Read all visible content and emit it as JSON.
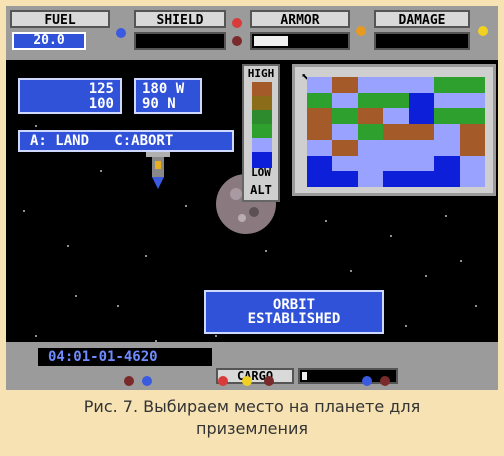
{
  "gauges": {
    "fuel_label": "FUEL",
    "fuel_value": "20.0",
    "shield_label": "SHIELD",
    "armor_label": "ARMOR",
    "damage_label": "DAMAGE",
    "shield_level": 0.0,
    "armor_level": 0.35,
    "damage_level": 0.0
  },
  "navigation": {
    "coord_1": "125",
    "coord_2": "100",
    "lat": "180 W",
    "lon": "90 N",
    "commands": "A: LAND   C:ABORT"
  },
  "altitude_legend": {
    "high": "HIGH",
    "low": "LOW",
    "alt": "ALT",
    "colors": [
      "#a55a2a",
      "#8b6c19",
      "#2d8b2d",
      "#2ea02e",
      "#9aa2ff",
      "#0d1fd8"
    ]
  },
  "map": {
    "cells": [
      [
        "#9aa2ff",
        "#a55a2a",
        "#9aa2ff",
        "#9aa2ff",
        "#9aa2ff",
        "#2ea02e",
        "#2ea02e"
      ],
      [
        "#2ea02e",
        "#9aa2ff",
        "#2ea02e",
        "#2ea02e",
        "#0d1fd8",
        "#9aa2ff",
        "#9aa2ff"
      ],
      [
        "#a55a2a",
        "#2ea02e",
        "#a55a2a",
        "#9aa2ff",
        "#0d1fd8",
        "#2ea02e",
        "#2ea02e"
      ],
      [
        "#a55a2a",
        "#9aa2ff",
        "#2ea02e",
        "#a55a2a",
        "#a55a2a",
        "#9aa2ff",
        "#a55a2a"
      ],
      [
        "#9aa2ff",
        "#a55a2a",
        "#9aa2ff",
        "#9aa2ff",
        "#9aa2ff",
        "#9aa2ff",
        "#a55a2a"
      ],
      [
        "#0d1fd8",
        "#9aa2ff",
        "#9aa2ff",
        "#9aa2ff",
        "#9aa2ff",
        "#0d1fd8",
        "#9aa2ff"
      ],
      [
        "#0d1fd8",
        "#0d1fd8",
        "#9aa2ff",
        "#0d1fd8",
        "#0d1fd8",
        "#0d1fd8",
        "#9aa2ff"
      ]
    ]
  },
  "status": {
    "line1": "ORBIT",
    "line2": "ESTABLISHED"
  },
  "bottom": {
    "date": "04:01-01-4620",
    "cargo_label": "CARGO",
    "cargo_level": 0.05
  },
  "caption": {
    "line1": "Рис. 7. Выбираем место на планете для",
    "line2": "приземления"
  }
}
